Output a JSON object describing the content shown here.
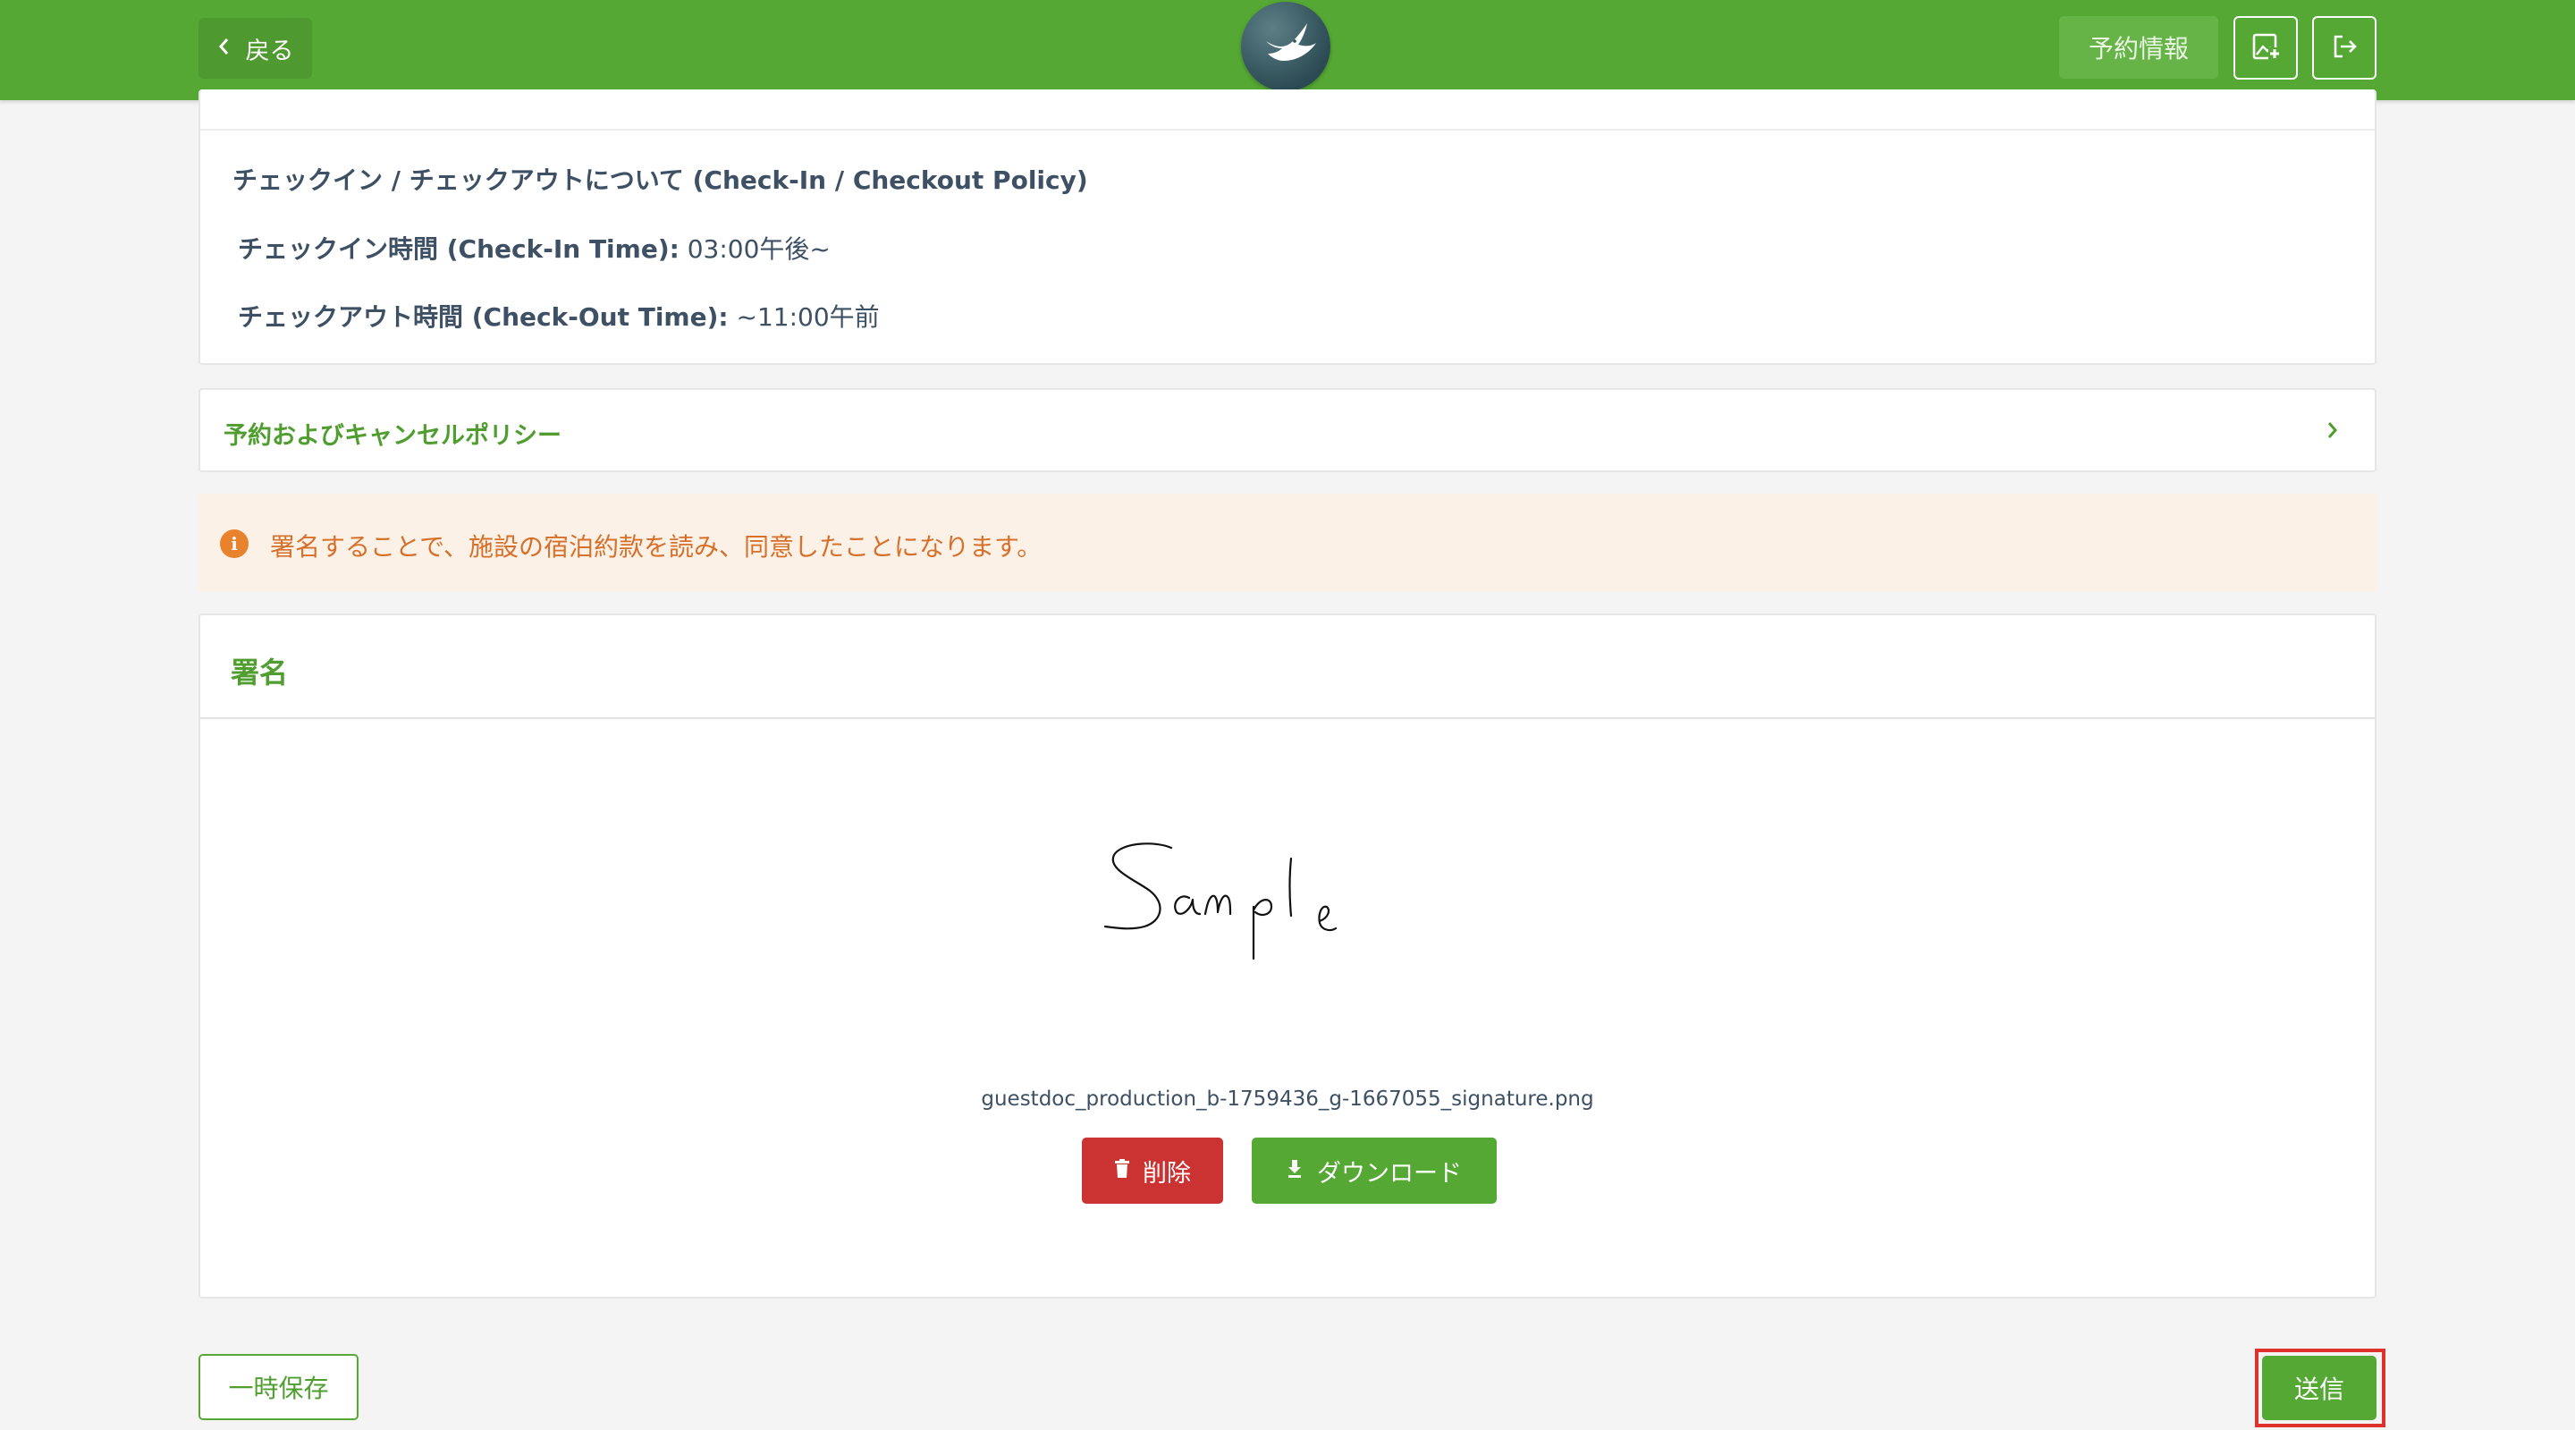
{
  "header": {
    "back_label": "戻る",
    "back_icon": "chevron-left-icon",
    "logo_icon": "bird-logo-icon",
    "reservation_info_label": "予約情報",
    "add_image_icon": "add-image-icon",
    "logout_icon": "logout-icon",
    "brand_color": "#55a834"
  },
  "policy": {
    "title": "チェックイン / チェックアウトについて (Check-In / Checkout Policy)",
    "checkin_label": "チェックイン時間 (Check-In Time):",
    "checkin_value": "03:00午後~",
    "checkout_label": "チェックアウト時間 (Check-Out Time):",
    "checkout_value": "~11:00午前"
  },
  "cancel_policy": {
    "label": "予約およびキャンセルポリシー",
    "icon": "chevron-right-icon"
  },
  "notice": {
    "icon": "info-icon",
    "text": "署名することで、施設の宿泊約款を読み、同意したことになります。",
    "color": "#d6702a"
  },
  "signature": {
    "title": "署名",
    "filename": "guestdoc_production_b-1759436_g-1667055_signature.png",
    "delete_label": "削除",
    "delete_icon": "trash-icon",
    "download_label": "ダウンロード",
    "download_icon": "download-icon"
  },
  "footer": {
    "save_label": "一時保存",
    "submit_label": "送信"
  }
}
